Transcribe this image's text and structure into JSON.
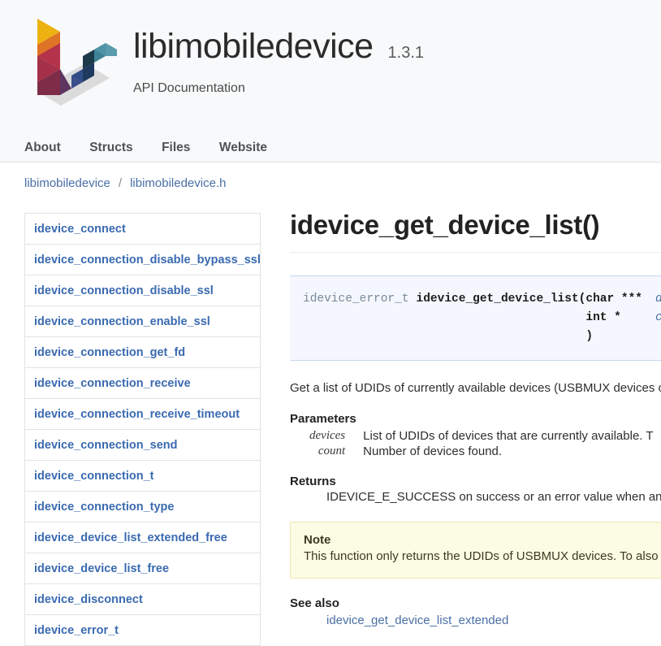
{
  "header": {
    "logo_name": "libimobiledevice-logo",
    "title": "libimobiledevice",
    "version": "1.3.1",
    "subtitle": "API Documentation",
    "nav": [
      {
        "label": "About"
      },
      {
        "label": "Structs"
      },
      {
        "label": "Files"
      },
      {
        "label": "Website"
      }
    ]
  },
  "breadcrumb": {
    "items": [
      {
        "label": "libimobiledevice"
      },
      {
        "label": "libimobiledevice.h"
      }
    ],
    "separator": "/"
  },
  "sidebar": {
    "items": [
      {
        "label": "idevice_connect"
      },
      {
        "label": "idevice_connection_disable_bypass_ssl"
      },
      {
        "label": "idevice_connection_disable_ssl"
      },
      {
        "label": "idevice_connection_enable_ssl"
      },
      {
        "label": "idevice_connection_get_fd"
      },
      {
        "label": "idevice_connection_receive"
      },
      {
        "label": "idevice_connection_receive_timeout"
      },
      {
        "label": "idevice_connection_send"
      },
      {
        "label": "idevice_connection_t"
      },
      {
        "label": "idevice_connection_type"
      },
      {
        "label": "idevice_device_list_extended_free"
      },
      {
        "label": "idevice_device_list_free"
      },
      {
        "label": "idevice_disconnect"
      },
      {
        "label": "idevice_error_t"
      }
    ]
  },
  "main": {
    "title": "idevice_get_device_list()",
    "signature": {
      "return_type": "idevice_error_t",
      "function_name": "idevice_get_device_list",
      "open_paren": "(",
      "close_paren": ")",
      "params": [
        {
          "type": "char ***",
          "name": "devices"
        },
        {
          "type": "int *",
          "name": "count"
        }
      ]
    },
    "description": "Get a list of UDIDs of currently available devices (USBMUX devices only)",
    "parameters_heading": "Parameters",
    "parameters": [
      {
        "name": "devices",
        "desc": "List of UDIDs of devices that are currently available. T"
      },
      {
        "name": "count",
        "desc": "Number of devices found."
      }
    ],
    "returns_heading": "Returns",
    "returns_text": "IDEVICE_E_SUCCESS on success or an error value when an erro",
    "note": {
      "title": "Note",
      "text": "This function only returns the UDIDs of USBMUX devices. To also inclu"
    },
    "seealso_heading": "See also",
    "seealso_links": [
      {
        "label": "idevice_get_device_list_extended"
      }
    ]
  },
  "colors": {
    "header_bg": "#f8f9fa",
    "link_blue": "#4a6fa5",
    "sidebar_link": "#3a6ab0",
    "code_bg": "#f4f7fd",
    "code_border": "#c7d6ef",
    "note_bg": "#fcfbe3",
    "note_border": "#ebe9b8",
    "logo_gold": "#edb211",
    "logo_orange": "#de7426",
    "logo_crimson": "#b5334a",
    "logo_maroon": "#8e2f46",
    "logo_purple": "#6a3a63",
    "logo_indigo": "#2f4c86",
    "logo_navy": "#1f3a5f",
    "logo_darkteal": "#1c3b4a",
    "logo_teal": "#3f8296",
    "logo_lightteal": "#4e93a6",
    "logo_shadow": "#d6d6d6"
  }
}
